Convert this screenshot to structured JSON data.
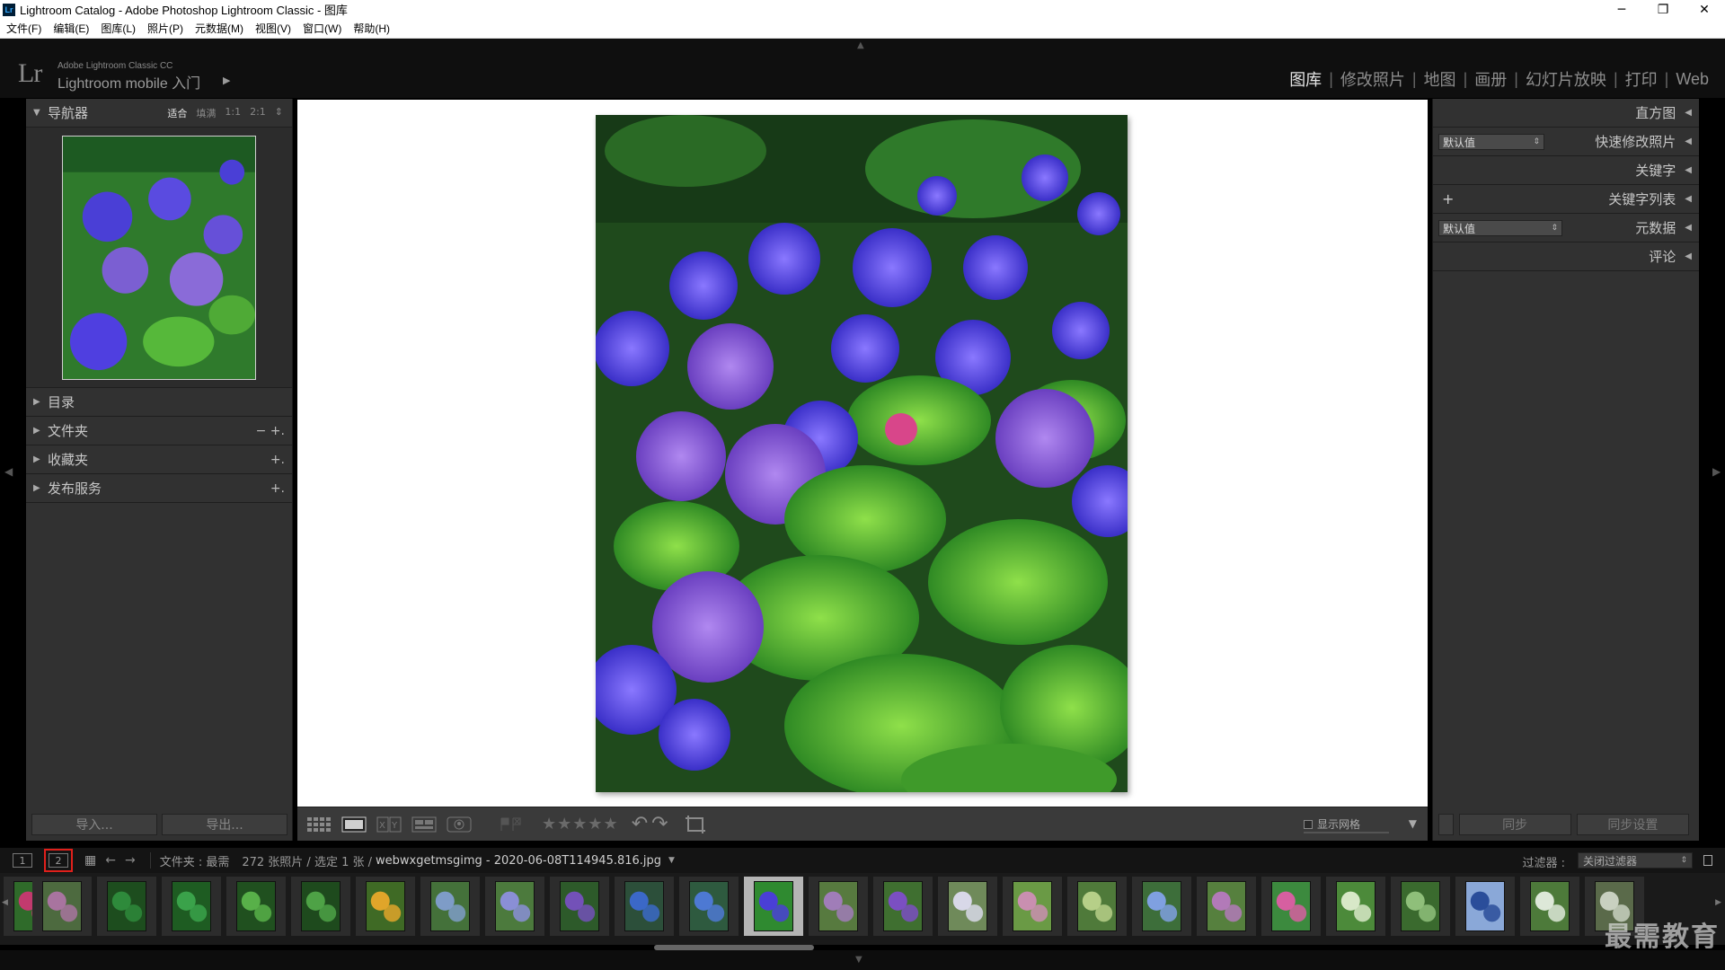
{
  "window": {
    "title": "Lightroom Catalog - Adobe Photoshop Lightroom Classic - 图库",
    "app_badge": "Lr",
    "minimize": "─",
    "restore": "❐",
    "close": "✕"
  },
  "menubar": {
    "items": [
      "文件(F)",
      "编辑(E)",
      "图库(L)",
      "照片(P)",
      "元数据(M)",
      "视图(V)",
      "窗口(W)",
      "帮助(H)"
    ]
  },
  "identity": {
    "logo": "Lr",
    "line1": "Adobe Lightroom Classic CC",
    "line2": "Lightroom mobile 入门"
  },
  "modules": [
    {
      "label": "图库",
      "active": true
    },
    {
      "label": "修改照片",
      "active": false
    },
    {
      "label": "地图",
      "active": false
    },
    {
      "label": "画册",
      "active": false
    },
    {
      "label": "幻灯片放映",
      "active": false
    },
    {
      "label": "打印",
      "active": false
    },
    {
      "label": "Web",
      "active": false
    }
  ],
  "left_panel": {
    "navigator": {
      "label": "导航器",
      "zoom_options": [
        "适合",
        "填满",
        "1:1",
        "2:1"
      ],
      "active_zoom": "适合"
    },
    "sections": [
      {
        "label": "目录",
        "actions": ""
      },
      {
        "label": "文件夹",
        "actions": "−  +."
      },
      {
        "label": "收藏夹",
        "actions": "+."
      },
      {
        "label": "发布服务",
        "actions": "+."
      }
    ],
    "import_button": "导入...",
    "export_button": "导出..."
  },
  "right_panel": {
    "histogram": "直方图",
    "quick_develop": "快速修改照片",
    "quick_develop_preset": "默认值",
    "keywording": "关键字",
    "keyword_list": "关键字列表",
    "keyword_plus": "+",
    "metadata": "元数据",
    "metadata_preset": "默认值",
    "comments": "评论",
    "sync_button": "同步",
    "sync_settings_button": "同步设置"
  },
  "toolbar": {
    "stars": "★★★★★",
    "show_grid_label": "显示网格"
  },
  "filmstrip_bar": {
    "window1": "1",
    "window2": "2",
    "source": "文件夹 : 最需",
    "count": "272 张照片 / 选定 1 张 /",
    "filename": "webwxgetmsgimg - 2020-06-08T114945.816.jpg",
    "filter_label": "过滤器 :",
    "filter_value": "关闭过滤器"
  },
  "filmstrip": {
    "selected_index": 12,
    "thumbs": [
      {
        "c1": "#c23a6e",
        "c2": "#2f6b2a"
      },
      {
        "c1": "#a8749f",
        "c2": "#4d6a3f"
      },
      {
        "c1": "#2e8a3b",
        "c2": "#1d4d1e"
      },
      {
        "c1": "#3aa24a",
        "c2": "#1e5c22"
      },
      {
        "c1": "#58b049",
        "c2": "#20501f"
      },
      {
        "c1": "#4ea246",
        "c2": "#1e4a1d"
      },
      {
        "c1": "#e0a52a",
        "c2": "#3f6a25"
      },
      {
        "c1": "#7e9cc7",
        "c2": "#44713a"
      },
      {
        "c1": "#8a8fd6",
        "c2": "#4c7a3d"
      },
      {
        "c1": "#7351b8",
        "c2": "#2d5a2a"
      },
      {
        "c1": "#3b68c7",
        "c2": "#2c4f3a"
      },
      {
        "c1": "#4d79d3",
        "c2": "#2e5a3f"
      },
      {
        "c1": "#4a3fd6",
        "c2": "#2f8a30"
      },
      {
        "c1": "#a07db8",
        "c2": "#577a3f"
      },
      {
        "c1": "#7b4fc2",
        "c2": "#3f6f30"
      },
      {
        "c1": "#d8d8e8",
        "c2": "#6f8a5a"
      },
      {
        "c1": "#c98fb0",
        "c2": "#6a9a45"
      },
      {
        "c1": "#b6cf88",
        "c2": "#4f7a3a"
      },
      {
        "c1": "#7fa0e0",
        "c2": "#3d6e3a"
      },
      {
        "c1": "#b27ab8",
        "c2": "#56803e"
      },
      {
        "c1": "#d65fa0",
        "c2": "#3c8a3e"
      },
      {
        "c1": "#d8e8c8",
        "c2": "#4c8a3a"
      },
      {
        "c1": "#8fbf7a",
        "c2": "#3a6a2e"
      },
      {
        "c1": "#2a4d9a",
        "c2": "#8aa8d8"
      },
      {
        "c1": "#dde8d8",
        "c2": "#4d7a3a"
      },
      {
        "c1": "#c8d0c0",
        "c2": "#5a6a4a"
      }
    ]
  },
  "watermark": "最需教育",
  "colors": {
    "panel_bg": "#313131",
    "workspace_bg": "#ffffff",
    "selection_outline": "#e0201b"
  }
}
